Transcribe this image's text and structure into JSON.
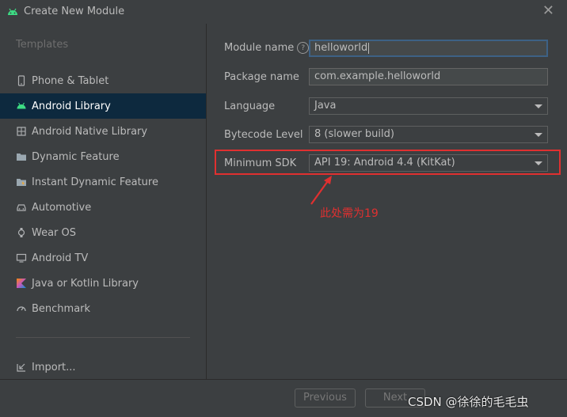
{
  "window": {
    "title": "Create New Module",
    "close_symbol": "✕"
  },
  "sidebar": {
    "heading": "Templates",
    "items": [
      {
        "label": "Phone & Tablet",
        "icon": "phone-icon",
        "selected": false
      },
      {
        "label": "Android Library",
        "icon": "android-icon",
        "selected": true
      },
      {
        "label": "Android Native Library",
        "icon": "native-library-icon",
        "selected": false
      },
      {
        "label": "Dynamic Feature",
        "icon": "folder-icon",
        "selected": false
      },
      {
        "label": "Instant Dynamic Feature",
        "icon": "instant-folder-icon",
        "selected": false
      },
      {
        "label": "Automotive",
        "icon": "car-icon",
        "selected": false
      },
      {
        "label": "Wear OS",
        "icon": "watch-icon",
        "selected": false
      },
      {
        "label": "Android TV",
        "icon": "tv-icon",
        "selected": false
      },
      {
        "label": "Java or Kotlin Library",
        "icon": "kotlin-icon",
        "selected": false
      },
      {
        "label": "Benchmark",
        "icon": "gauge-icon",
        "selected": false
      }
    ],
    "import_label": "Import..."
  },
  "form": {
    "module_name": {
      "label": "Module name",
      "value": "helloworld"
    },
    "package_name": {
      "label": "Package name",
      "value": "com.example.helloworld"
    },
    "language": {
      "label": "Language",
      "value": "Java"
    },
    "bytecode_level": {
      "label": "Bytecode Level",
      "value": "8 (slower build)"
    },
    "minimum_sdk": {
      "label": "Minimum SDK",
      "value": "API 19: Android 4.4 (KitKat)"
    }
  },
  "annotation": {
    "text": "此处需为19",
    "color": "#e03030"
  },
  "footer": {
    "previous_label": "Previous",
    "next_label": "Next"
  },
  "watermark": "CSDN @徐徐的毛毛虫",
  "colors": {
    "selected_bg": "#0d293e",
    "android_green": "#3ddc84",
    "focus_border": "#3d6185"
  }
}
